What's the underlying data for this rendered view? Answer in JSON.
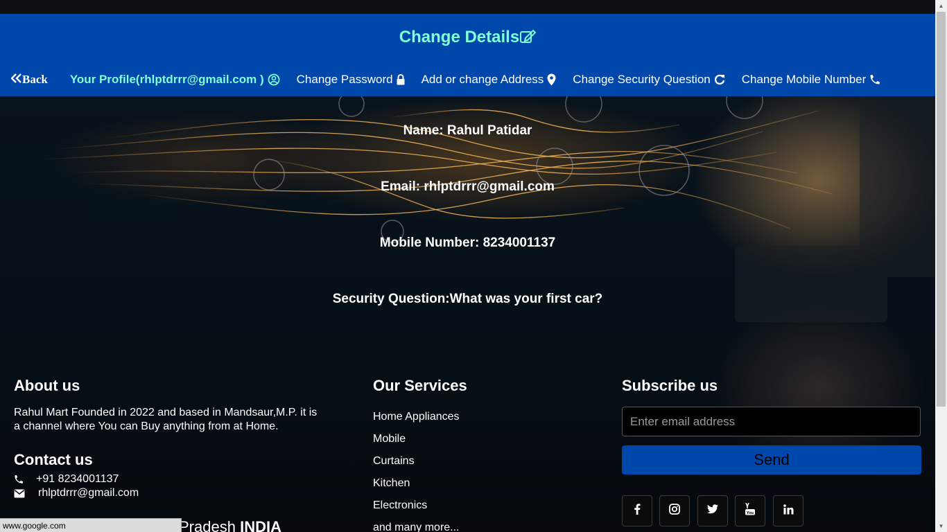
{
  "header": {
    "title": "Change Details",
    "nav": {
      "back": "Back",
      "profile": "Your Profile(rhlptdrrr@gmail.com )",
      "change_password": "Change Password",
      "address": "Add or change Address",
      "security": "Change Security Question",
      "mobile": "Change Mobile Number"
    }
  },
  "details": {
    "name": "Name: Rahul Patidar",
    "email": "Email: rhlptdrrr@gmail.com",
    "mobile": "Mobile Number: 8234001137",
    "security": "Security Question:What was your first car?"
  },
  "footer": {
    "about_title": "About us",
    "about_text": "Rahul Mart Founded in 2022 and based in Mandsaur,M.P. it is a channel where You can Buy anything from at Home.",
    "contact_title": "Contact us",
    "phone": "+91 8234001137",
    "email": "rhlptdrrr@gmail.com",
    "partial_location_text": "Pradesh",
    "partial_location_bold": "INDIA",
    "services_title": "Our Services",
    "services": [
      "Home Appliances",
      "Mobile",
      "Curtains",
      "Kitchen",
      "Electronics",
      "and many more..."
    ],
    "subscribe_title": "Subscribe us",
    "email_placeholder": "Enter email address",
    "send_label": "Send",
    "social_icons": [
      "facebook-icon",
      "instagram-icon",
      "twitter-icon",
      "youtube-icon",
      "linkedin-icon"
    ]
  },
  "statusbar": {
    "url": "www.google.com"
  },
  "colors": {
    "header_bg": "#0047ab",
    "accent": "#7fffd4",
    "send_bg": "#0047ab"
  }
}
